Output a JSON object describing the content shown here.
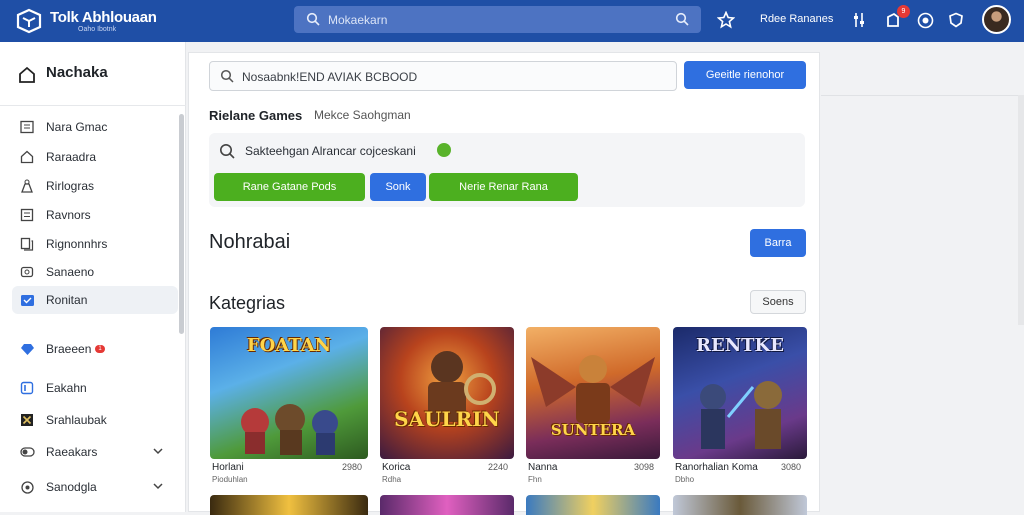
{
  "app": {
    "brand": "Tolk Abhlouaan",
    "brand_sub": "Oaho Ibotnk",
    "search_placeholder": "Mokaekarn",
    "header_link": "Rdee Rananes",
    "notification_count": "9"
  },
  "sidebar": {
    "heading": "Nachaka",
    "items": [
      {
        "label": "Nara Gmac",
        "icon": "list-icon"
      },
      {
        "label": "Raraadra",
        "icon": "home-icon"
      },
      {
        "label": "Rirlogras",
        "icon": "user-icon"
      },
      {
        "label": "Ravnors",
        "icon": "document-icon"
      },
      {
        "label": "Rignonnhrs",
        "icon": "pages-icon"
      },
      {
        "label": "Sanaeno",
        "icon": "image-icon"
      },
      {
        "label": "Ronitan",
        "icon": "folder-icon"
      },
      {
        "label": "Braeeen",
        "icon": "diamond-icon",
        "badge": "1"
      },
      {
        "label": "Eakahn",
        "icon": "bar-icon"
      },
      {
        "label": "Srahlaubak",
        "icon": "x-icon"
      },
      {
        "label": "Raeakars",
        "icon": "toggle-icon"
      },
      {
        "label": "Sanodgla",
        "icon": "settings-icon"
      }
    ]
  },
  "main": {
    "search_value": "Nosaabnk!END AVIAK BCBOOD",
    "search_button": "Geeitle rienohor",
    "tab_active": "Rielane Games",
    "tab_second": "Mekce Saohgman",
    "panel_title": "Sakteehgan Alrancar cojceskani",
    "chip_1": "Rane   Gatane   Pods",
    "chip_2": "Sonk",
    "chip_3": "Nerie   Renar   Rana",
    "section_1": "Nohrabai",
    "section_1_button": "Barra",
    "section_2": "Kategrias",
    "section_2_button": "Soens",
    "cards": [
      {
        "thumb_title": "FOATAN",
        "name": "Horlani",
        "sub": "Pioduhlan",
        "count": "2980"
      },
      {
        "thumb_title": "SAULRIN",
        "name": "Korica",
        "sub": "Rdha",
        "count": "2240"
      },
      {
        "thumb_title": "SUNTERA",
        "name": "Nanna",
        "sub": "Fhn",
        "count": "3098"
      },
      {
        "thumb_title": "RENTKE",
        "name": "Ranorhalian Koma",
        "sub": "Dbho",
        "count": "3080"
      }
    ]
  },
  "colors": {
    "topbar": "#1f4fa6",
    "accent_blue": "#2f6fe0",
    "accent_green": "#4caf1f"
  }
}
